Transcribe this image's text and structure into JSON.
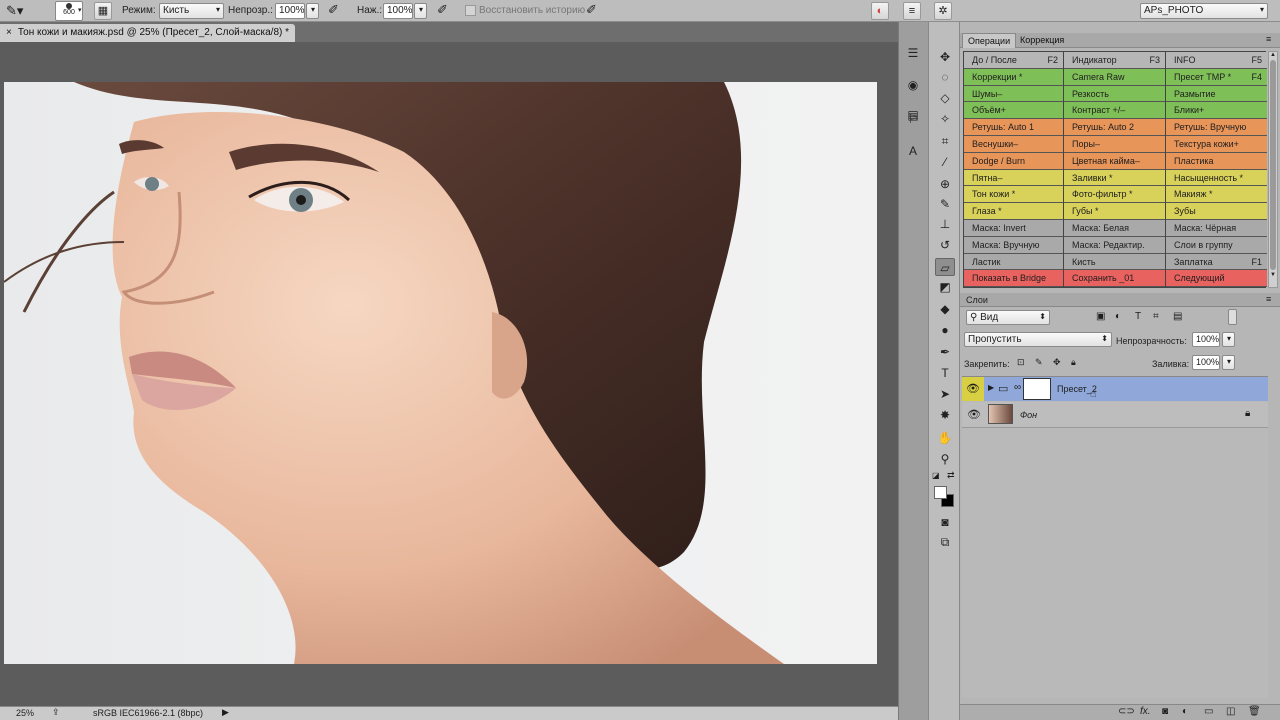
{
  "options_bar": {
    "brush_size": "600",
    "mode_label": "Режим:",
    "mode_value": "Кисть",
    "opacity_label": "Непрозр.:",
    "opacity_value": "100%",
    "pressure_label": "Наж.:",
    "pressure_value": "100%",
    "restore_history": "Восстановить историю",
    "workspace": "APs_PHOTO"
  },
  "document_tab": {
    "title": "Тон кожи и макияж.psd @ 25% (Пресет_2, Слой-маска/8) *"
  },
  "status_bar": {
    "zoom": "25%",
    "profile": "sRGB IEC61966-2.1 (8bpc)"
  },
  "panels": {
    "operations_tab": "Операции",
    "correction_tab": "Коррекция",
    "operations": [
      [
        {
          "label": "До / После",
          "key": "F2",
          "color": "#b6b6b6"
        },
        {
          "label": "Индикатор",
          "key": "F3",
          "color": "#b6b6b6"
        },
        {
          "label": "INFO",
          "key": "F5",
          "color": "#b6b6b6"
        }
      ],
      [
        {
          "label": "Коррекции *",
          "key": "",
          "color": "#7fbf57"
        },
        {
          "label": "Camera Raw",
          "key": "",
          "color": "#7fbf57"
        },
        {
          "label": "Пресет TMP *",
          "key": "F4",
          "color": "#7fbf57"
        }
      ],
      [
        {
          "label": "Шумы–",
          "key": "",
          "color": "#7fbf57"
        },
        {
          "label": "Резкость",
          "key": "",
          "color": "#7fbf57"
        },
        {
          "label": "Размытие",
          "key": "",
          "color": "#7fbf57"
        }
      ],
      [
        {
          "label": "Объём+",
          "key": "",
          "color": "#7fbf57"
        },
        {
          "label": "Контраст +/–",
          "key": "",
          "color": "#7fbf57"
        },
        {
          "label": "Блики+",
          "key": "",
          "color": "#7fbf57"
        }
      ],
      [
        {
          "label": "Ретушь: Auto 1",
          "key": "",
          "color": "#e8955a"
        },
        {
          "label": "Ретушь: Auto 2",
          "key": "",
          "color": "#e8955a"
        },
        {
          "label": "Ретушь: Вручную",
          "key": "",
          "color": "#e8955a"
        }
      ],
      [
        {
          "label": "Веснушки–",
          "key": "",
          "color": "#e8955a"
        },
        {
          "label": "Поры–",
          "key": "",
          "color": "#e8955a"
        },
        {
          "label": "Текстура кожи+",
          "key": "",
          "color": "#e8955a"
        }
      ],
      [
        {
          "label": "Dodge / Burn",
          "key": "",
          "color": "#e8955a"
        },
        {
          "label": "Цветная кайма–",
          "key": "",
          "color": "#e8955a"
        },
        {
          "label": "Пластика",
          "key": "",
          "color": "#e8955a"
        }
      ],
      [
        {
          "label": "Пятна–",
          "key": "",
          "color": "#d8d15a"
        },
        {
          "label": "Заливки *",
          "key": "",
          "color": "#d8d15a"
        },
        {
          "label": "Насыщенность *",
          "key": "",
          "color": "#d8d15a"
        }
      ],
      [
        {
          "label": "Тон кожи *",
          "key": "",
          "color": "#d8d15a"
        },
        {
          "label": "Фото-фильтр *",
          "key": "",
          "color": "#d8d15a"
        },
        {
          "label": "Макияж *",
          "key": "",
          "color": "#d8d15a"
        }
      ],
      [
        {
          "label": "Глаза *",
          "key": "",
          "color": "#d8d15a"
        },
        {
          "label": "Губы *",
          "key": "",
          "color": "#d8d15a"
        },
        {
          "label": "Зубы",
          "key": "",
          "color": "#d8d15a"
        }
      ],
      [
        {
          "label": "Маска: Invert",
          "key": "",
          "color": "#a9a9a9"
        },
        {
          "label": "Маска: Белая",
          "key": "",
          "color": "#a9a9a9"
        },
        {
          "label": "Маска: Чёрная",
          "key": "",
          "color": "#a9a9a9"
        }
      ],
      [
        {
          "label": "Маска: Вручную",
          "key": "",
          "color": "#a9a9a9"
        },
        {
          "label": "Маска: Редактир.",
          "key": "",
          "color": "#a9a9a9"
        },
        {
          "label": "Слои в группу",
          "key": "",
          "color": "#a9a9a9"
        }
      ],
      [
        {
          "label": "Ластик",
          "key": "",
          "color": "#a9a9a9"
        },
        {
          "label": "Кисть",
          "key": "",
          "color": "#a9a9a9"
        },
        {
          "label": "Заплатка",
          "key": "F1",
          "color": "#a9a9a9"
        }
      ],
      [
        {
          "label": "Показать в Bridge",
          "key": "",
          "color": "#e8625f"
        },
        {
          "label": "Сохранить _01",
          "key": "",
          "color": "#e8625f"
        },
        {
          "label": "Следующий",
          "key": "",
          "color": "#e8625f"
        }
      ]
    ],
    "layers_title": "Слои",
    "layers_filter": "Вид",
    "blend_mode": "Пропустить",
    "opacity_label": "Непрозрачность:",
    "opacity_value": "100%",
    "lock_label": "Закрепить:",
    "fill_label": "Заливка:",
    "fill_value": "100%",
    "layers": [
      {
        "name": "Пресет_2"
      },
      {
        "name": "Фон"
      }
    ]
  }
}
